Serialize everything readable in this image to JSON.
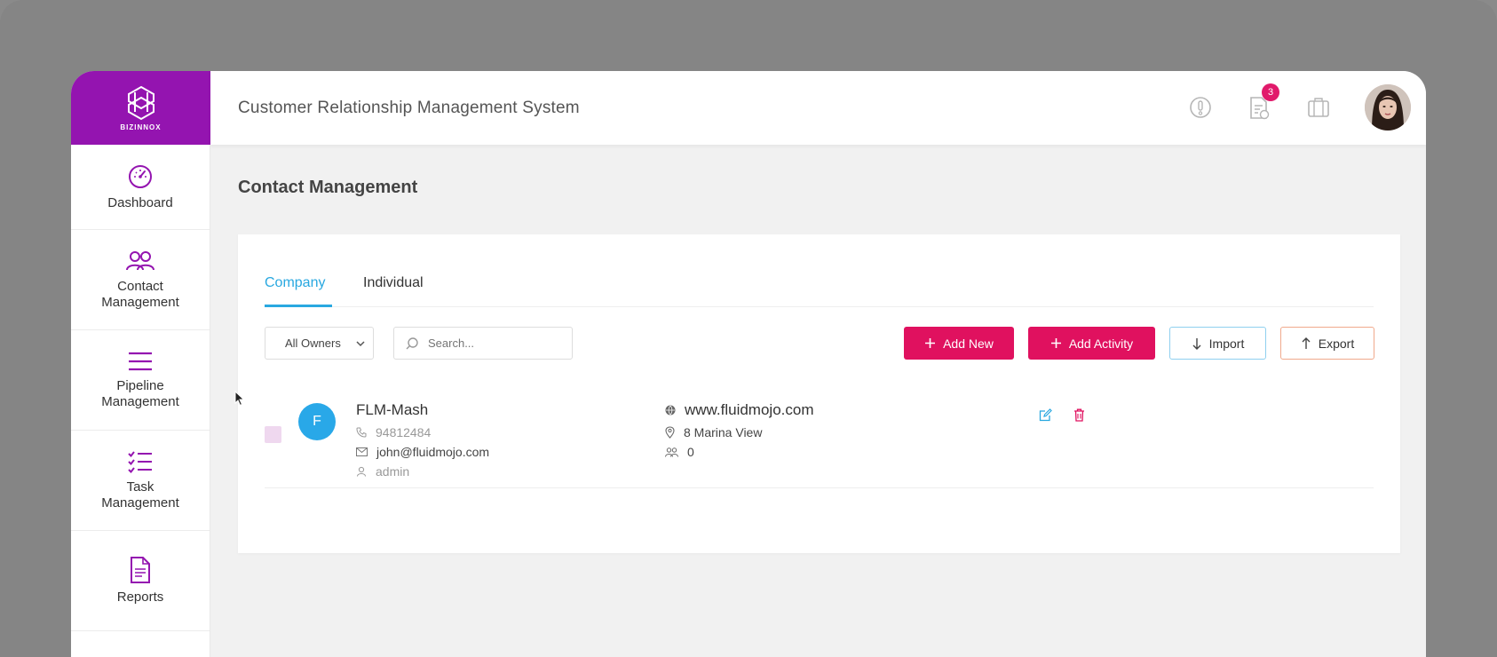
{
  "app": {
    "logo_text": "BIZINNOX",
    "header_title": "Customer Relationship Management System",
    "notification_count": "3"
  },
  "sidebar": {
    "items": [
      {
        "label": "Dashboard",
        "icon": "speedometer-icon"
      },
      {
        "label": "Contact Management",
        "icon": "users-icon"
      },
      {
        "label": "Pipeline Management",
        "icon": "menu-lines-icon"
      },
      {
        "label": "Task Management",
        "icon": "checklist-icon"
      },
      {
        "label": "Reports",
        "icon": "document-icon"
      }
    ]
  },
  "main": {
    "page_title": "Contact Management",
    "tabs": [
      {
        "label": "Company",
        "active": true
      },
      {
        "label": "Individual",
        "active": false
      }
    ],
    "filter": {
      "owner_selected": "All Owners"
    },
    "search": {
      "placeholder": "Search..."
    },
    "buttons": {
      "add_new": "Add New",
      "add_activity": "Add Activity",
      "import": "Import",
      "export": "Export"
    },
    "contacts": [
      {
        "initial": "F",
        "name": "FLM-Mash",
        "phone": "94812484",
        "email": "john@fluidmojo.com",
        "owner": "admin",
        "website": "www.fluidmojo.com",
        "address": "8 Marina View",
        "people_count": "0"
      }
    ]
  },
  "colors": {
    "brand_purple": "#9414b0",
    "accent_blue": "#29a8e0",
    "primary_pink": "#e0115f"
  }
}
